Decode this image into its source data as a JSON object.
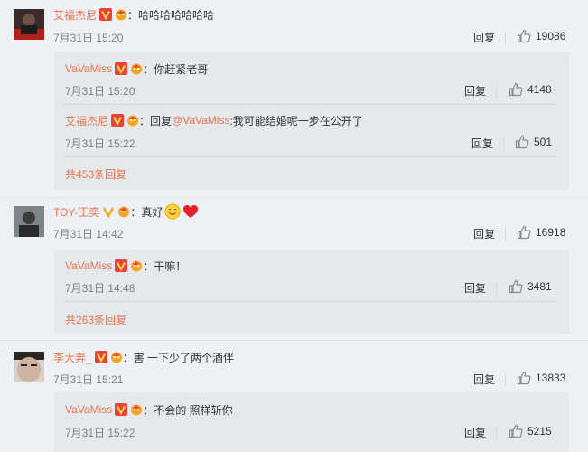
{
  "colors": {
    "accent": "#eb7350",
    "meta": "#808080",
    "sub_bg": "#e6e9ec",
    "page_bg": "#eef1f4"
  },
  "icons": {
    "verified": "verified-v-icon",
    "member": "member-crown-icon",
    "like": "thumb-up-icon"
  },
  "comments": [
    {
      "user": "艾福杰尼",
      "text": "：哈哈哈哈哈哈哈",
      "time": "7月31日 15:20",
      "reply": "回复",
      "likes": "19086",
      "subreplies": [
        {
          "user": "VaVaMiss",
          "text": "：你赶紧老哥",
          "time": "7月31日 15:20",
          "reply": "回复",
          "likes": "4148"
        },
        {
          "user": "艾福杰尼",
          "prefix": "：回复",
          "mention": "@VaVaMiss",
          "text": ":我可能结婚呢一步在公开了",
          "time": "7月31日 15:22",
          "reply": "回复",
          "likes": "501"
        }
      ],
      "more": "共453条回复"
    },
    {
      "user": "TOY-王奕",
      "text": "：真好",
      "time": "7月31日 14:42",
      "reply": "回复",
      "likes": "16918",
      "subreplies": [
        {
          "user": "VaVaMiss",
          "text": "：干嘛！",
          "time": "7月31日 14:48",
          "reply": "回复",
          "likes": "3481"
        }
      ],
      "more": "共263条回复"
    },
    {
      "user": "李大奔_",
      "text": "：害 一下少了两个酒伴",
      "time": "7月31日 15:21",
      "reply": "回复",
      "likes": "13833",
      "subreplies": [
        {
          "user": "VaVaMiss",
          "text": "：不会的 照样斩你",
          "time": "7月31日 15:22",
          "reply": "回复",
          "likes": "5215"
        }
      ]
    }
  ]
}
